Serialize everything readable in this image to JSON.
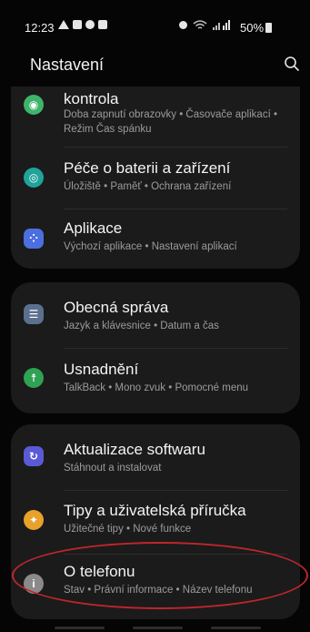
{
  "status": {
    "time": "12:23",
    "battery": "50%"
  },
  "header": {
    "title": "Nastavení"
  },
  "groups": [
    {
      "items": [
        {
          "title": "kontrola",
          "subtitle": "Doba zapnutí obrazovky • Časovače aplikací • Režim Čas spánku",
          "icon": "digital-wellbeing-icon",
          "color": "#3fb36b"
        },
        {
          "title": "Péče o baterii a zařízení",
          "subtitle": "Úložiště • Paměť • Ochrana zařízení",
          "icon": "device-care-icon",
          "color": "#1fa39a"
        },
        {
          "title": "Aplikace",
          "subtitle": "Výchozí aplikace • Nastavení aplikací",
          "icon": "apps-icon",
          "color": "#4c6fe0"
        }
      ]
    },
    {
      "items": [
        {
          "title": "Obecná správa",
          "subtitle": "Jazyk a klávesnice • Datum a čas",
          "icon": "general-management-icon",
          "color": "#5b6f8f"
        },
        {
          "title": "Usnadnění",
          "subtitle": "TalkBack • Mono zvuk • Pomocné menu",
          "icon": "accessibility-icon",
          "color": "#2fa254"
        }
      ]
    },
    {
      "items": [
        {
          "title": "Aktualizace softwaru",
          "subtitle": "Stáhnout a instalovat",
          "icon": "software-update-icon",
          "color": "#5a5ad6"
        },
        {
          "title": "Tipy a uživatelská příručka",
          "subtitle": "Užitečné tipy • Nové funkce",
          "icon": "tips-icon",
          "color": "#e8a12a"
        },
        {
          "title": "O telefonu",
          "subtitle": "Stav • Právní informace • Název telefonu",
          "icon": "about-phone-icon",
          "color": "#8a8a8a"
        }
      ]
    }
  ]
}
